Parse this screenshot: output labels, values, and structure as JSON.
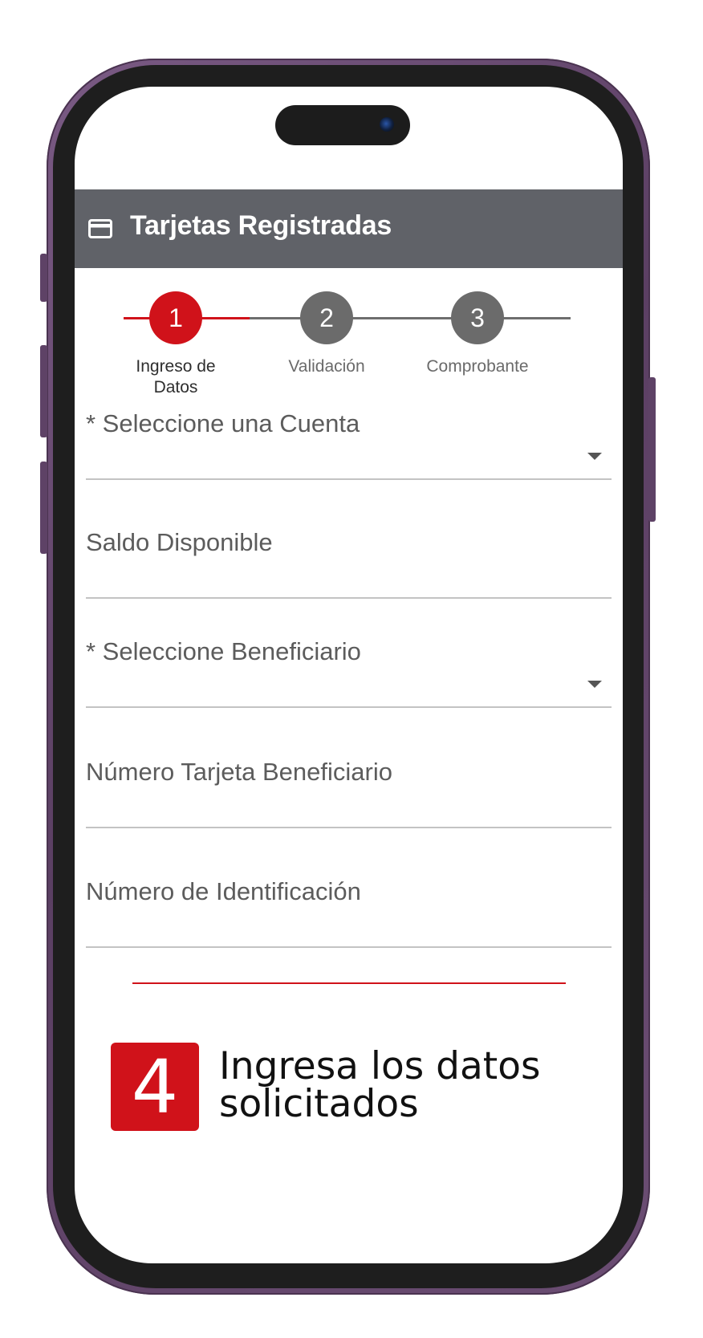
{
  "app": {
    "header_title": "Tarjetas Registradas",
    "header_icon": "credit-card-icon"
  },
  "stepper": {
    "steps": [
      {
        "number": "1",
        "label": "Ingreso de\nDatos",
        "state": "active"
      },
      {
        "number": "2",
        "label": "Validación",
        "state": "inactive"
      },
      {
        "number": "3",
        "label": "Comprobante",
        "state": "inactive"
      }
    ]
  },
  "form": {
    "account_label": "* Seleccione una Cuenta",
    "balance_label": "Saldo Disponible",
    "beneficiary_label": "* Seleccione Beneficiario",
    "card_number_label": "Número Tarjeta Beneficiario",
    "id_number_label": "Número de Identificación"
  },
  "tutorial": {
    "step_number": "4",
    "instruction": "Ingresa los datos solicitados"
  },
  "colors": {
    "accent": "#d0121a",
    "header_bg": "#606268",
    "inactive_step": "#6b6b6b",
    "phone_frame": "#6b4d73"
  }
}
